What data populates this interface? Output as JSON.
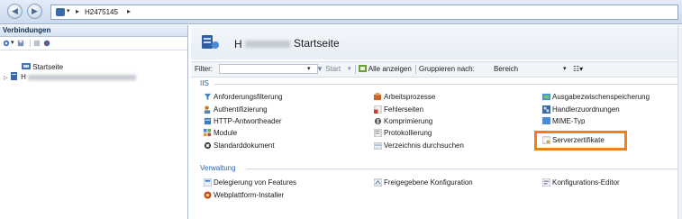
{
  "address": {
    "crumb": "H2475145",
    "arrow": "▸"
  },
  "connections": {
    "header": "Verbindungen",
    "tree": [
      {
        "label": "Startseite"
      },
      {
        "label": "H"
      }
    ]
  },
  "main": {
    "title_prefix": "H",
    "title": "Startseite",
    "filter": {
      "label": "Filter:",
      "start": "Start",
      "show_all": "Alle anzeigen",
      "group_by": "Gruppieren nach:",
      "group_value": "Bereich"
    },
    "sections": [
      {
        "name": "IIS",
        "columns": [
          [
            "Anforderungsfilterung",
            "Authentifizierung",
            "HTTP-Antwortheader",
            "Module",
            "Standarddokument"
          ],
          [
            "Arbeitsprozesse",
            "Fehlerseiten",
            "Komprimierung",
            "Protokollierung",
            "Verzeichnis durchsuchen"
          ],
          [
            "Ausgabezwischenspeicherung",
            "Handlerzuordnungen",
            "MIME-Typ",
            "Serverzertifikate"
          ]
        ]
      },
      {
        "name": "Verwaltung",
        "columns": [
          [
            "Delegierung von Features",
            "Webplattform-Installer"
          ],
          [
            "Freigegebene Konfiguration"
          ],
          [
            "Konfigurations-Editor"
          ]
        ]
      }
    ]
  },
  "colors": {
    "highlight": "#f07f1f",
    "section_head": "#2a64b0"
  }
}
